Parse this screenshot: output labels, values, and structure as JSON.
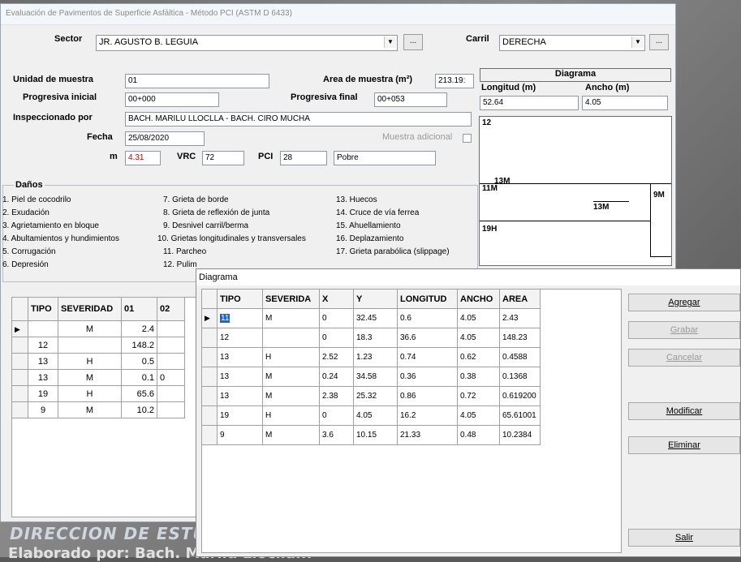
{
  "window": {
    "title": "Evaluación de Pavimentos de Superficie Asfáltica - Método PCI (ASTM D 6433)"
  },
  "background": {
    "heading": "DIRECCION DE ESTUDI",
    "subheading": "Elaborado por: Bach. Marilu Lloclla..."
  },
  "form": {
    "sector_label": "Sector",
    "sector_value": "JR. AGUSTO B. LEGUIA",
    "carril_label": "Carril",
    "carril_value": "DERECHA",
    "unidad_label": "Unidad de muestra",
    "unidad_value": "01",
    "area_label": "Area de muestra (m²)",
    "area_value": "213.19:",
    "prog_ini_label": "Progresiva inicial",
    "prog_ini_value": "00+000",
    "prog_fin_label": "Progresiva final",
    "prog_fin_value": "00+053",
    "insp_label": "Inspeccionado por",
    "insp_value": "BACH. MARILU LLOCLLA - BACH. CIRO MUCHA",
    "fecha_label": "Fecha",
    "fecha_value": "25/08/2020",
    "muestra_adic_label": "Muestra adicional",
    "m_label": "m",
    "m_value": "4.31",
    "vrc_label": "VRC",
    "vrc_value": "72",
    "pci_label": "PCI",
    "pci_value": "28",
    "pci_cond": "Pobre",
    "browse_btn": "..."
  },
  "diagram_panel": {
    "title": "Diagrama",
    "longitud_label": "Longitud (m)",
    "ancho_label": "Ancho (m)",
    "longitud_value": "52.64",
    "ancho_value": "4.05",
    "labels": [
      "12",
      "13M",
      "11M",
      "9M",
      "13M",
      "19H"
    ]
  },
  "danos": {
    "title": "Daños",
    "col1": [
      "1. Piel de cocodrilo",
      "2. Exudación",
      "3. Agrietamiento en bloque",
      "4. Abultamientos y hundimientos",
      "5. Corrugación",
      "6. Depresión"
    ],
    "col2": [
      "7. Grieta de borde",
      "8. Grieta de reflexión de junta",
      "9. Desnivel carril/berma",
      "10. Grietas longitudinales y transversales",
      "11. Parcheo",
      "12. Pulim"
    ],
    "col3": [
      "13. Huecos",
      "14. Cruce de vía ferrea",
      "15. Ahuellamiento",
      "16. Deplazamiento",
      "17. Grieta parabólica (slippage)"
    ]
  },
  "left_grid": {
    "headers": [
      "TIPO",
      "SEVERIDAD",
      "01",
      "02"
    ],
    "rows": [
      {
        "tipo": "",
        "sev": "M",
        "c1": "2.4",
        "c2": ""
      },
      {
        "tipo": "12",
        "sev": "",
        "c1": "148.2",
        "c2": ""
      },
      {
        "tipo": "13",
        "sev": "H",
        "c1": "0.5",
        "c2": ""
      },
      {
        "tipo": "13",
        "sev": "M",
        "c1": "0.1",
        "c2": "0"
      },
      {
        "tipo": "19",
        "sev": "H",
        "c1": "65.6",
        "c2": ""
      },
      {
        "tipo": "9",
        "sev": "M",
        "c1": "10.2",
        "c2": ""
      }
    ]
  },
  "dialog": {
    "title": "Diagrama",
    "headers": [
      "TIPO",
      "SEVERIDA",
      "X",
      "Y",
      "LONGITUD",
      "ANCHO",
      "AREA"
    ],
    "rows": [
      {
        "tipo": "11",
        "sev": "M",
        "x": "0",
        "y": "32.45",
        "lon": "0.6",
        "anc": "4.05",
        "area": "2.43"
      },
      {
        "tipo": "12",
        "sev": "",
        "x": "0",
        "y": "18.3",
        "lon": "36.6",
        "anc": "4.05",
        "area": "148.23"
      },
      {
        "tipo": "13",
        "sev": "H",
        "x": "2.52",
        "y": "1.23",
        "lon": "0.74",
        "anc": "0.62",
        "area": "0.4588"
      },
      {
        "tipo": "13",
        "sev": "M",
        "x": "0.24",
        "y": "34.58",
        "lon": "0.36",
        "anc": "0.38",
        "area": "0.1368"
      },
      {
        "tipo": "13",
        "sev": "M",
        "x": "2.38",
        "y": "25.32",
        "lon": "0.86",
        "anc": "0.72",
        "area": "0.619200"
      },
      {
        "tipo": "19",
        "sev": "H",
        "x": "0",
        "y": "4.05",
        "lon": "16.2",
        "anc": "4.05",
        "area": "65.61001"
      },
      {
        "tipo": "9",
        "sev": "M",
        "x": "3.6",
        "y": "10.15",
        "lon": "21.33",
        "anc": "0.48",
        "area": "10.2384"
      }
    ],
    "buttons": {
      "agregar": "Agregar",
      "grabar": "Grabar",
      "cancelar": "Cancelar",
      "modificar": "Modificar",
      "eliminar": "Eliminar",
      "salir": "Salir"
    }
  }
}
